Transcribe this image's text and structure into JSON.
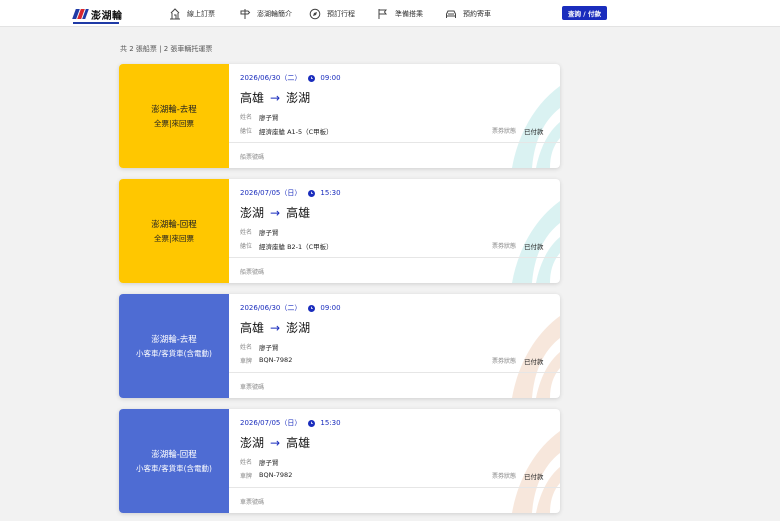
{
  "header": {
    "logo_text": "澎湖輪",
    "nav": [
      {
        "label": "線上訂票",
        "icon": "ticket-booth-icon"
      },
      {
        "label": "澎湖輪簡介",
        "icon": "signpost-icon"
      },
      {
        "label": "預訂行程",
        "icon": "compass-icon"
      },
      {
        "label": "準備搭乘",
        "icon": "flag-icon"
      },
      {
        "label": "預約寄車",
        "icon": "car-icon"
      }
    ],
    "query_button": "查詢 / 付款"
  },
  "summary": "共 2 張船票 | 2 張車輛托運票",
  "labels": {
    "name": "姓名",
    "seat": "艙位",
    "plate": "車牌",
    "status": "票券狀態",
    "ticket_no": "船票號碼",
    "vehicle_no": "車票號碼"
  },
  "tickets": [
    {
      "kind": "passenger",
      "color": "#ffc700",
      "title": "澎湖輪-去程",
      "subtitle": "全票|來回票",
      "date": "2026/06/30（二）",
      "time": "09:00",
      "from": "高雄",
      "to": "澎湖",
      "arrow": "→",
      "name": "廖子賢",
      "detail": "經濟座艙 A1-5（C甲板）",
      "status": "已付款"
    },
    {
      "kind": "passenger",
      "color": "#ffc700",
      "title": "澎湖輪-回程",
      "subtitle": "全票|來回票",
      "date": "2026/07/05（日）",
      "time": "15:30",
      "from": "澎湖",
      "to": "高雄",
      "arrow": "→",
      "name": "廖子賢",
      "detail": "經濟座艙 B2-1（C甲板）",
      "status": "已付款"
    },
    {
      "kind": "vehicle",
      "color": "#4e6cd3",
      "title": "澎湖輪-去程",
      "subtitle": "小客車/客貨車(含電動)",
      "date": "2026/06/30（二）",
      "time": "09:00",
      "from": "高雄",
      "to": "澎湖",
      "arrow": "→",
      "name": "廖子賢",
      "detail": "BQN-7982",
      "status": "已付款"
    },
    {
      "kind": "vehicle",
      "color": "#4e6cd3",
      "title": "澎湖輪-回程",
      "subtitle": "小客車/客貨車(含電動)",
      "date": "2026/07/05（日）",
      "time": "15:30",
      "from": "澎湖",
      "to": "高雄",
      "arrow": "→",
      "name": "廖子賢",
      "detail": "BQN-7982",
      "status": "已付款"
    }
  ]
}
